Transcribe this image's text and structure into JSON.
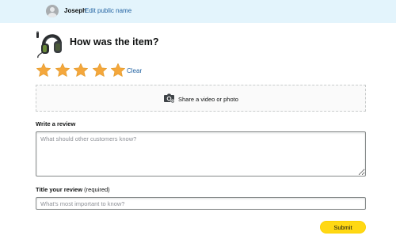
{
  "header": {
    "username": "Joseph",
    "edit_link": "Edit public name",
    "avatar_icon": "user-avatar-icon"
  },
  "product": {
    "image_icon": "headset-icon",
    "heading": "How was the item?"
  },
  "rating": {
    "value": 5,
    "max": 5,
    "star_color": "#f4a73c",
    "clear_label": "Clear"
  },
  "media": {
    "icon": "camera-icon",
    "label": "Share a video or photo"
  },
  "review": {
    "label": "Write a review",
    "placeholder": "What should other customers know?"
  },
  "title": {
    "label": "Title your review",
    "required_note": "(required)",
    "placeholder": "What's most important to know?"
  },
  "submit_label": "Submit",
  "colors": {
    "header_bg": "#e3f4fc",
    "link": "#2162a1",
    "submit_bg": "#ffd814"
  }
}
